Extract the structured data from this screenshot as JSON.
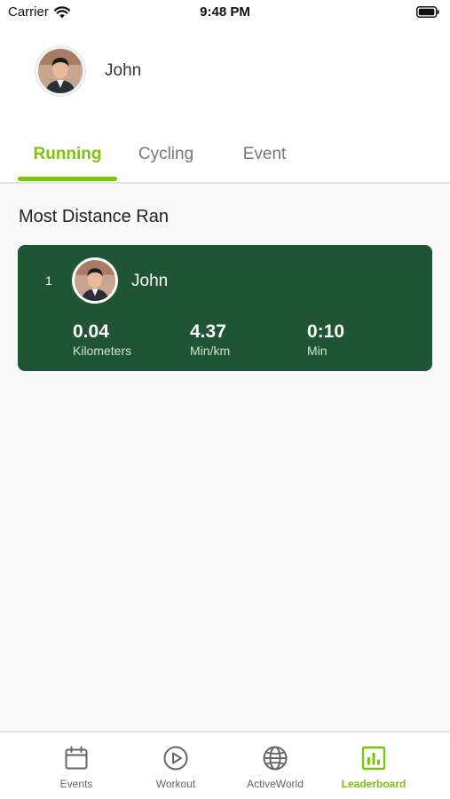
{
  "status_bar": {
    "carrier": "Carrier",
    "time": "9:48 PM"
  },
  "profile": {
    "name": "John"
  },
  "tabs": [
    {
      "label": "Running",
      "active": true
    },
    {
      "label": "Cycling",
      "active": false
    },
    {
      "label": "Event",
      "active": false
    }
  ],
  "section": {
    "title": "Most Distance Ran"
  },
  "leaderboard": [
    {
      "rank": "1",
      "name": "John",
      "stats": [
        {
          "value": "0.04",
          "label": "Kilometers"
        },
        {
          "value": "4.37",
          "label": "Min/km"
        },
        {
          "value": "0:10",
          "label": "Min"
        }
      ]
    }
  ],
  "bottom_nav": [
    {
      "label": "Events",
      "icon": "calendar-icon",
      "active": false
    },
    {
      "label": "Workout",
      "icon": "play-circle-icon",
      "active": false
    },
    {
      "label": "ActiveWorld",
      "icon": "globe-icon",
      "active": false
    },
    {
      "label": "Leaderboard",
      "icon": "bar-chart-icon",
      "active": true
    }
  ],
  "colors": {
    "accent": "#7cc40f",
    "card": "#1f5535"
  }
}
